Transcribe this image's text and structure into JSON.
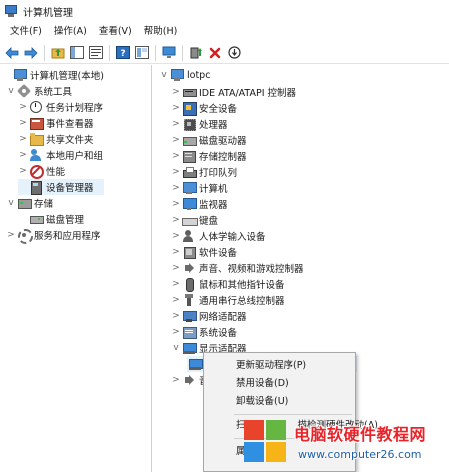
{
  "window": {
    "title": "计算机管理"
  },
  "menu": [
    "文件(F)",
    "操作(A)",
    "查看(V)",
    "帮助(H)"
  ],
  "toolbar": {
    "icons": [
      "back-arrow-icon",
      "forward-arrow-icon",
      "up-folder-icon",
      "show-hide-tree-icon",
      "properties-icon",
      "help-icon",
      "view-icon",
      "monitor-icon",
      "update-driver-icon",
      "uninstall-icon",
      "disable-device-icon"
    ]
  },
  "left_tree": [
    {
      "label": "计算机管理(本地)",
      "icon": "computer-icon",
      "expand": "",
      "indent": 0
    },
    {
      "label": "系统工具",
      "icon": "tools-icon",
      "expand": "v",
      "indent": 1
    },
    {
      "label": "任务计划程序",
      "icon": "clock-icon",
      "expand": ">",
      "indent": 2
    },
    {
      "label": "事件查看器",
      "icon": "event-viewer-icon",
      "expand": ">",
      "indent": 2
    },
    {
      "label": "共享文件夹",
      "icon": "shared-folder-icon",
      "expand": ">",
      "indent": 2
    },
    {
      "label": "本地用户和组",
      "icon": "users-icon",
      "expand": ">",
      "indent": 2
    },
    {
      "label": "性能",
      "icon": "performance-icon",
      "expand": ">",
      "indent": 2
    },
    {
      "label": "设备管理器",
      "icon": "device-manager-icon",
      "expand": "",
      "indent": 2,
      "selected": true
    },
    {
      "label": "存储",
      "icon": "storage-icon",
      "expand": "v",
      "indent": 1
    },
    {
      "label": "磁盘管理",
      "icon": "disk-icon",
      "expand": "",
      "indent": 2
    },
    {
      "label": "服务和应用程序",
      "icon": "services-icon",
      "expand": ">",
      "indent": 1
    }
  ],
  "right_tree": {
    "root": {
      "label": "lotpc",
      "icon": "computer-icon"
    },
    "items": [
      {
        "label": "IDE ATA/ATAPI 控制器",
        "icon": "ide-controller-icon",
        "expand": ">"
      },
      {
        "label": "安全设备",
        "icon": "security-device-icon",
        "expand": ">"
      },
      {
        "label": "处理器",
        "icon": "processor-icon",
        "expand": ">"
      },
      {
        "label": "磁盘驱动器",
        "icon": "disk-drive-icon",
        "expand": ">"
      },
      {
        "label": "存储控制器",
        "icon": "storage-controller-icon",
        "expand": ">"
      },
      {
        "label": "打印队列",
        "icon": "print-queue-icon",
        "expand": ">"
      },
      {
        "label": "计算机",
        "icon": "computer-icon",
        "expand": ">"
      },
      {
        "label": "监视器",
        "icon": "monitor-icon",
        "expand": ">"
      },
      {
        "label": "键盘",
        "icon": "keyboard-icon",
        "expand": ">"
      },
      {
        "label": "人体学输入设备",
        "icon": "hid-icon",
        "expand": ">"
      },
      {
        "label": "软件设备",
        "icon": "software-device-icon",
        "expand": ">"
      },
      {
        "label": "声音、视频和游戏控制器",
        "icon": "audio-icon",
        "expand": ">"
      },
      {
        "label": "鼠标和其他指针设备",
        "icon": "mouse-icon",
        "expand": ">"
      },
      {
        "label": "通用串行总线控制器",
        "icon": "usb-icon",
        "expand": ">"
      },
      {
        "label": "网络适配器",
        "icon": "network-adapter-icon",
        "expand": ">"
      },
      {
        "label": "系统设备",
        "icon": "system-device-icon",
        "expand": ">"
      },
      {
        "label": "显示适配器",
        "icon": "display-adapter-icon",
        "expand": "v"
      }
    ],
    "partial_last_label": "音"
  },
  "context_menu": {
    "items": [
      "更新驱动程序(P)",
      "禁用设备(D)",
      "卸载设备(U)"
    ],
    "partial_items": [
      "扫",
      "描检测硬件改动(A)",
      "属"
    ]
  },
  "watermark": {
    "title": "电脑软硬件教程网",
    "url": "www.computer26.com"
  },
  "colors": {
    "selection": "#e5f1fb",
    "watermark_red": "#e8242a",
    "watermark_blue": "#1f5fa8"
  }
}
